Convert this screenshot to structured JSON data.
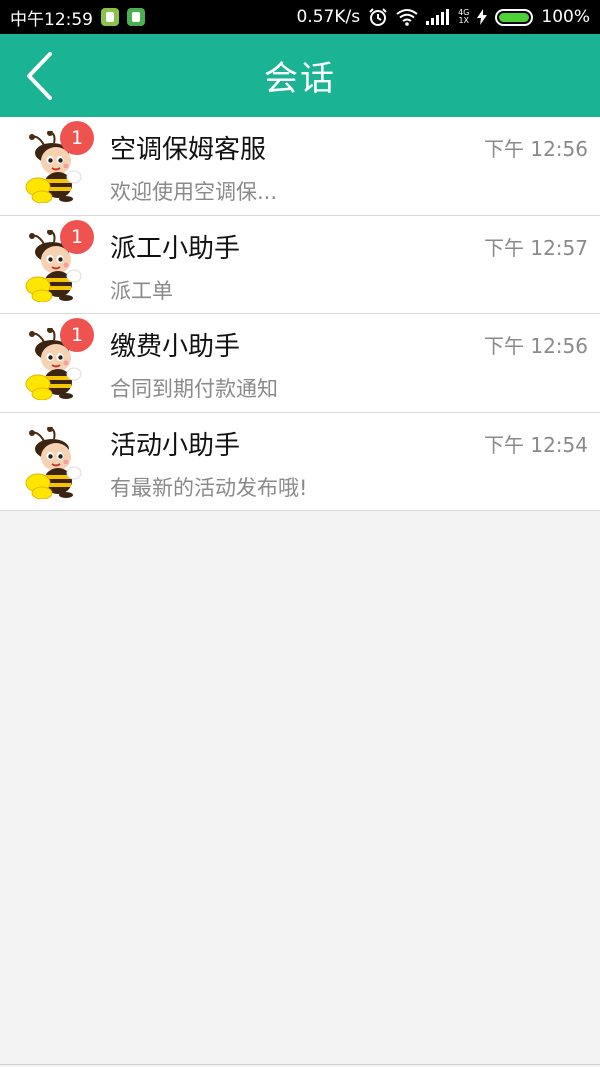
{
  "status_bar": {
    "time": "中午12:59",
    "network_speed": "0.57K/s",
    "network_type_top": "4G",
    "network_type_bottom": "1X",
    "battery_percent": "100%",
    "battery_level": 1.0,
    "icons": [
      "app-notification-icon",
      "app-notification-icon",
      "alarm-icon",
      "wifi-icon",
      "signal-icon",
      "charging-icon",
      "battery-icon"
    ]
  },
  "header": {
    "title": "会话",
    "back_icon": "chevron-left-icon",
    "background_color": "#1ab394"
  },
  "conversations": [
    {
      "name": "空调保姆客服",
      "preview": "欢迎使用空调保...",
      "time": "下午 12:56",
      "badge": "1"
    },
    {
      "name": "派工小助手",
      "preview": "派工单",
      "time": "下午 12:57",
      "badge": "1"
    },
    {
      "name": "缴费小助手",
      "preview": "合同到期付款通知",
      "time": "下午 12:56",
      "badge": "1"
    },
    {
      "name": "活动小助手",
      "preview": "有最新的活动发布哦!",
      "time": "下午 12:54",
      "badge": null
    }
  ],
  "colors": {
    "badge": "#ef5350",
    "time_text": "#8a8a8a",
    "preview_text": "#8a8a8a"
  }
}
